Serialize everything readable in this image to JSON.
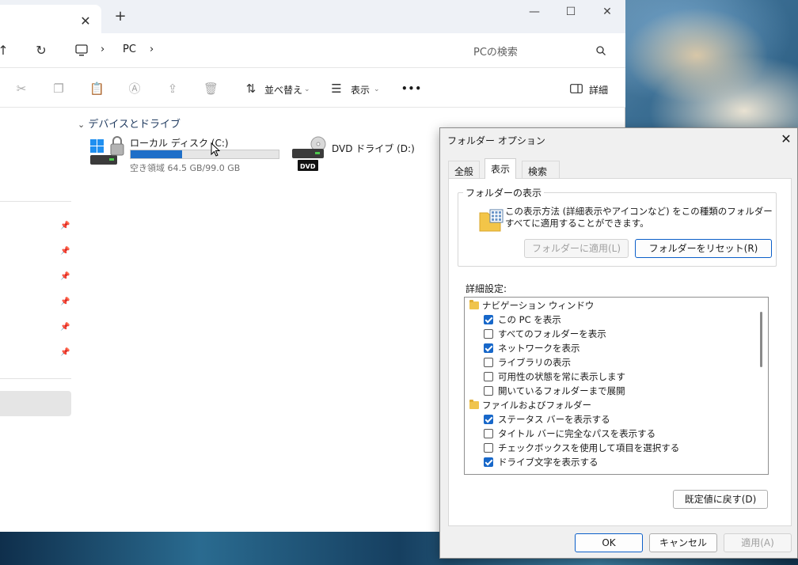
{
  "explorer": {
    "title_bar": {
      "close_tab": "✕",
      "add_tab": "+",
      "minimize": "—",
      "maximize": "☐",
      "close": "✕"
    },
    "address": {
      "crumb_pc": "PC",
      "search_placeholder": "PCの検索"
    },
    "toolbar": {
      "sort_label": "並べ替え",
      "view_label": "表示",
      "more_label": "•••",
      "details_label": "詳細"
    },
    "group_header": "デバイスとドライブ",
    "drives": [
      {
        "label": "ローカル ディスク (C:)",
        "free_text": "空き領域 64.5 GB/99.0 GB",
        "used_fraction": 0.35
      },
      {
        "label": "DVD ドライブ (D:)",
        "badge": "DVD"
      }
    ]
  },
  "dialog": {
    "title": "フォルダー オプション",
    "close": "✕",
    "tabs": [
      {
        "label": "全般"
      },
      {
        "label": "表示"
      },
      {
        "label": "検索"
      }
    ],
    "folder_views": {
      "title": "フォルダーの表示",
      "description": "この表示方法 (詳細表示やアイコンなど) をこの種類のフォルダーすべてに適用することができます。",
      "apply_button": "フォルダーに適用(L)",
      "reset_button": "フォルダーをリセット(R)"
    },
    "advanced_label": "詳細設定:",
    "advanced_items": [
      {
        "type": "folder",
        "label": "ナビゲーション ウィンドウ"
      },
      {
        "type": "check",
        "label": "この PC を表示",
        "checked": true
      },
      {
        "type": "check",
        "label": "すべてのフォルダーを表示",
        "checked": false
      },
      {
        "type": "check",
        "label": "ネットワークを表示",
        "checked": true
      },
      {
        "type": "check",
        "label": "ライブラリの表示",
        "checked": false
      },
      {
        "type": "check",
        "label": "可用性の状態を常に表示します",
        "checked": false
      },
      {
        "type": "check",
        "label": "開いているフォルダーまで展開",
        "checked": false
      },
      {
        "type": "folder",
        "label": "ファイルおよびフォルダー"
      },
      {
        "type": "check",
        "label": "ステータス バーを表示する",
        "checked": true
      },
      {
        "type": "check",
        "label": "タイトル バーに完全なパスを表示する",
        "checked": false
      },
      {
        "type": "check",
        "label": "チェックボックスを使用して項目を選択する",
        "checked": false
      },
      {
        "type": "check",
        "label": "ドライブ文字を表示する",
        "checked": true
      }
    ],
    "restore_defaults": "既定値に戻す(D)",
    "ok": "OK",
    "cancel": "キャンセル",
    "apply": "適用(A)"
  }
}
